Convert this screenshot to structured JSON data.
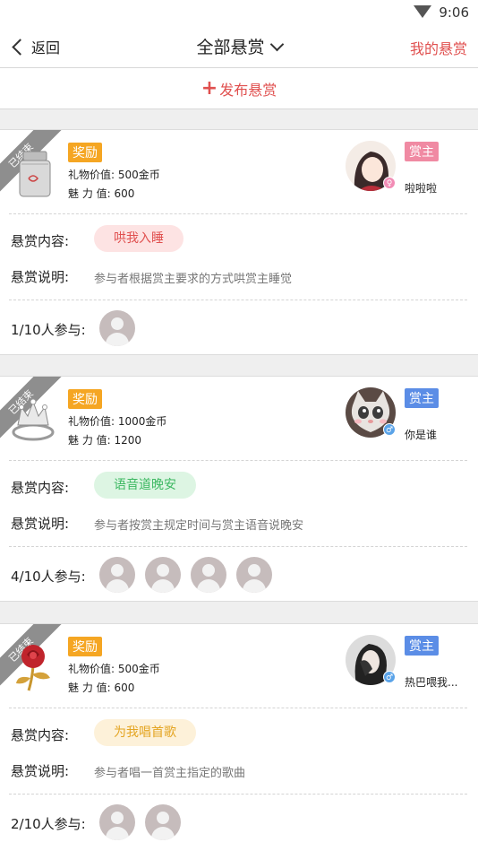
{
  "status": {
    "time": "9:06"
  },
  "nav": {
    "back_label": "返回",
    "title": "全部悬赏",
    "my_bounty": "我的悬赏"
  },
  "publish_label": "发布悬赏",
  "labels": {
    "content": "悬赏内容:",
    "note": "悬赏说明:"
  },
  "cards": [
    {
      "ribbon": "已结束",
      "reward_tag": "奖励",
      "gift_value": "礼物价值: 500金币",
      "charm": "魅 力 值: 600",
      "host_tag": "赏主",
      "host_tag_color": "#f08aa3",
      "nickname": "啦啦啦",
      "gender": "♀",
      "gender_color": "#f28cb5",
      "content": "哄我入睡",
      "pill_bg": "#fde3e3",
      "pill_color": "#e0504f",
      "note": "参与者根据赏主要求的方式哄赏主睡觉",
      "participants": "1/10人参与:",
      "participant_count": 1
    },
    {
      "ribbon": "已结束",
      "reward_tag": "奖励",
      "gift_value": "礼物价值: 1000金币",
      "charm": "魅 力 值: 1200",
      "host_tag": "赏主",
      "host_tag_color": "#5b8de6",
      "nickname": "你是谁",
      "gender": "♂",
      "gender_color": "#5aa3e8",
      "content": "语音道晚安",
      "pill_bg": "#ddf5e3",
      "pill_color": "#3db862",
      "note": "参与者按赏主规定时间与赏主语音说晚安",
      "participants": "4/10人参与:",
      "participant_count": 4
    },
    {
      "ribbon": "已结束",
      "reward_tag": "奖励",
      "gift_value": "礼物价值: 500金币",
      "charm": "魅 力 值: 600",
      "host_tag": "赏主",
      "host_tag_color": "#5b8de6",
      "nickname": "热巴喂我...",
      "gender": "♂",
      "gender_color": "#5aa3e8",
      "content": "为我唱首歌",
      "pill_bg": "#fdf1d9",
      "pill_color": "#e4a523",
      "note": "参与者唱一首赏主指定的歌曲",
      "participants": "2/10人参与:",
      "participant_count": 2
    }
  ]
}
